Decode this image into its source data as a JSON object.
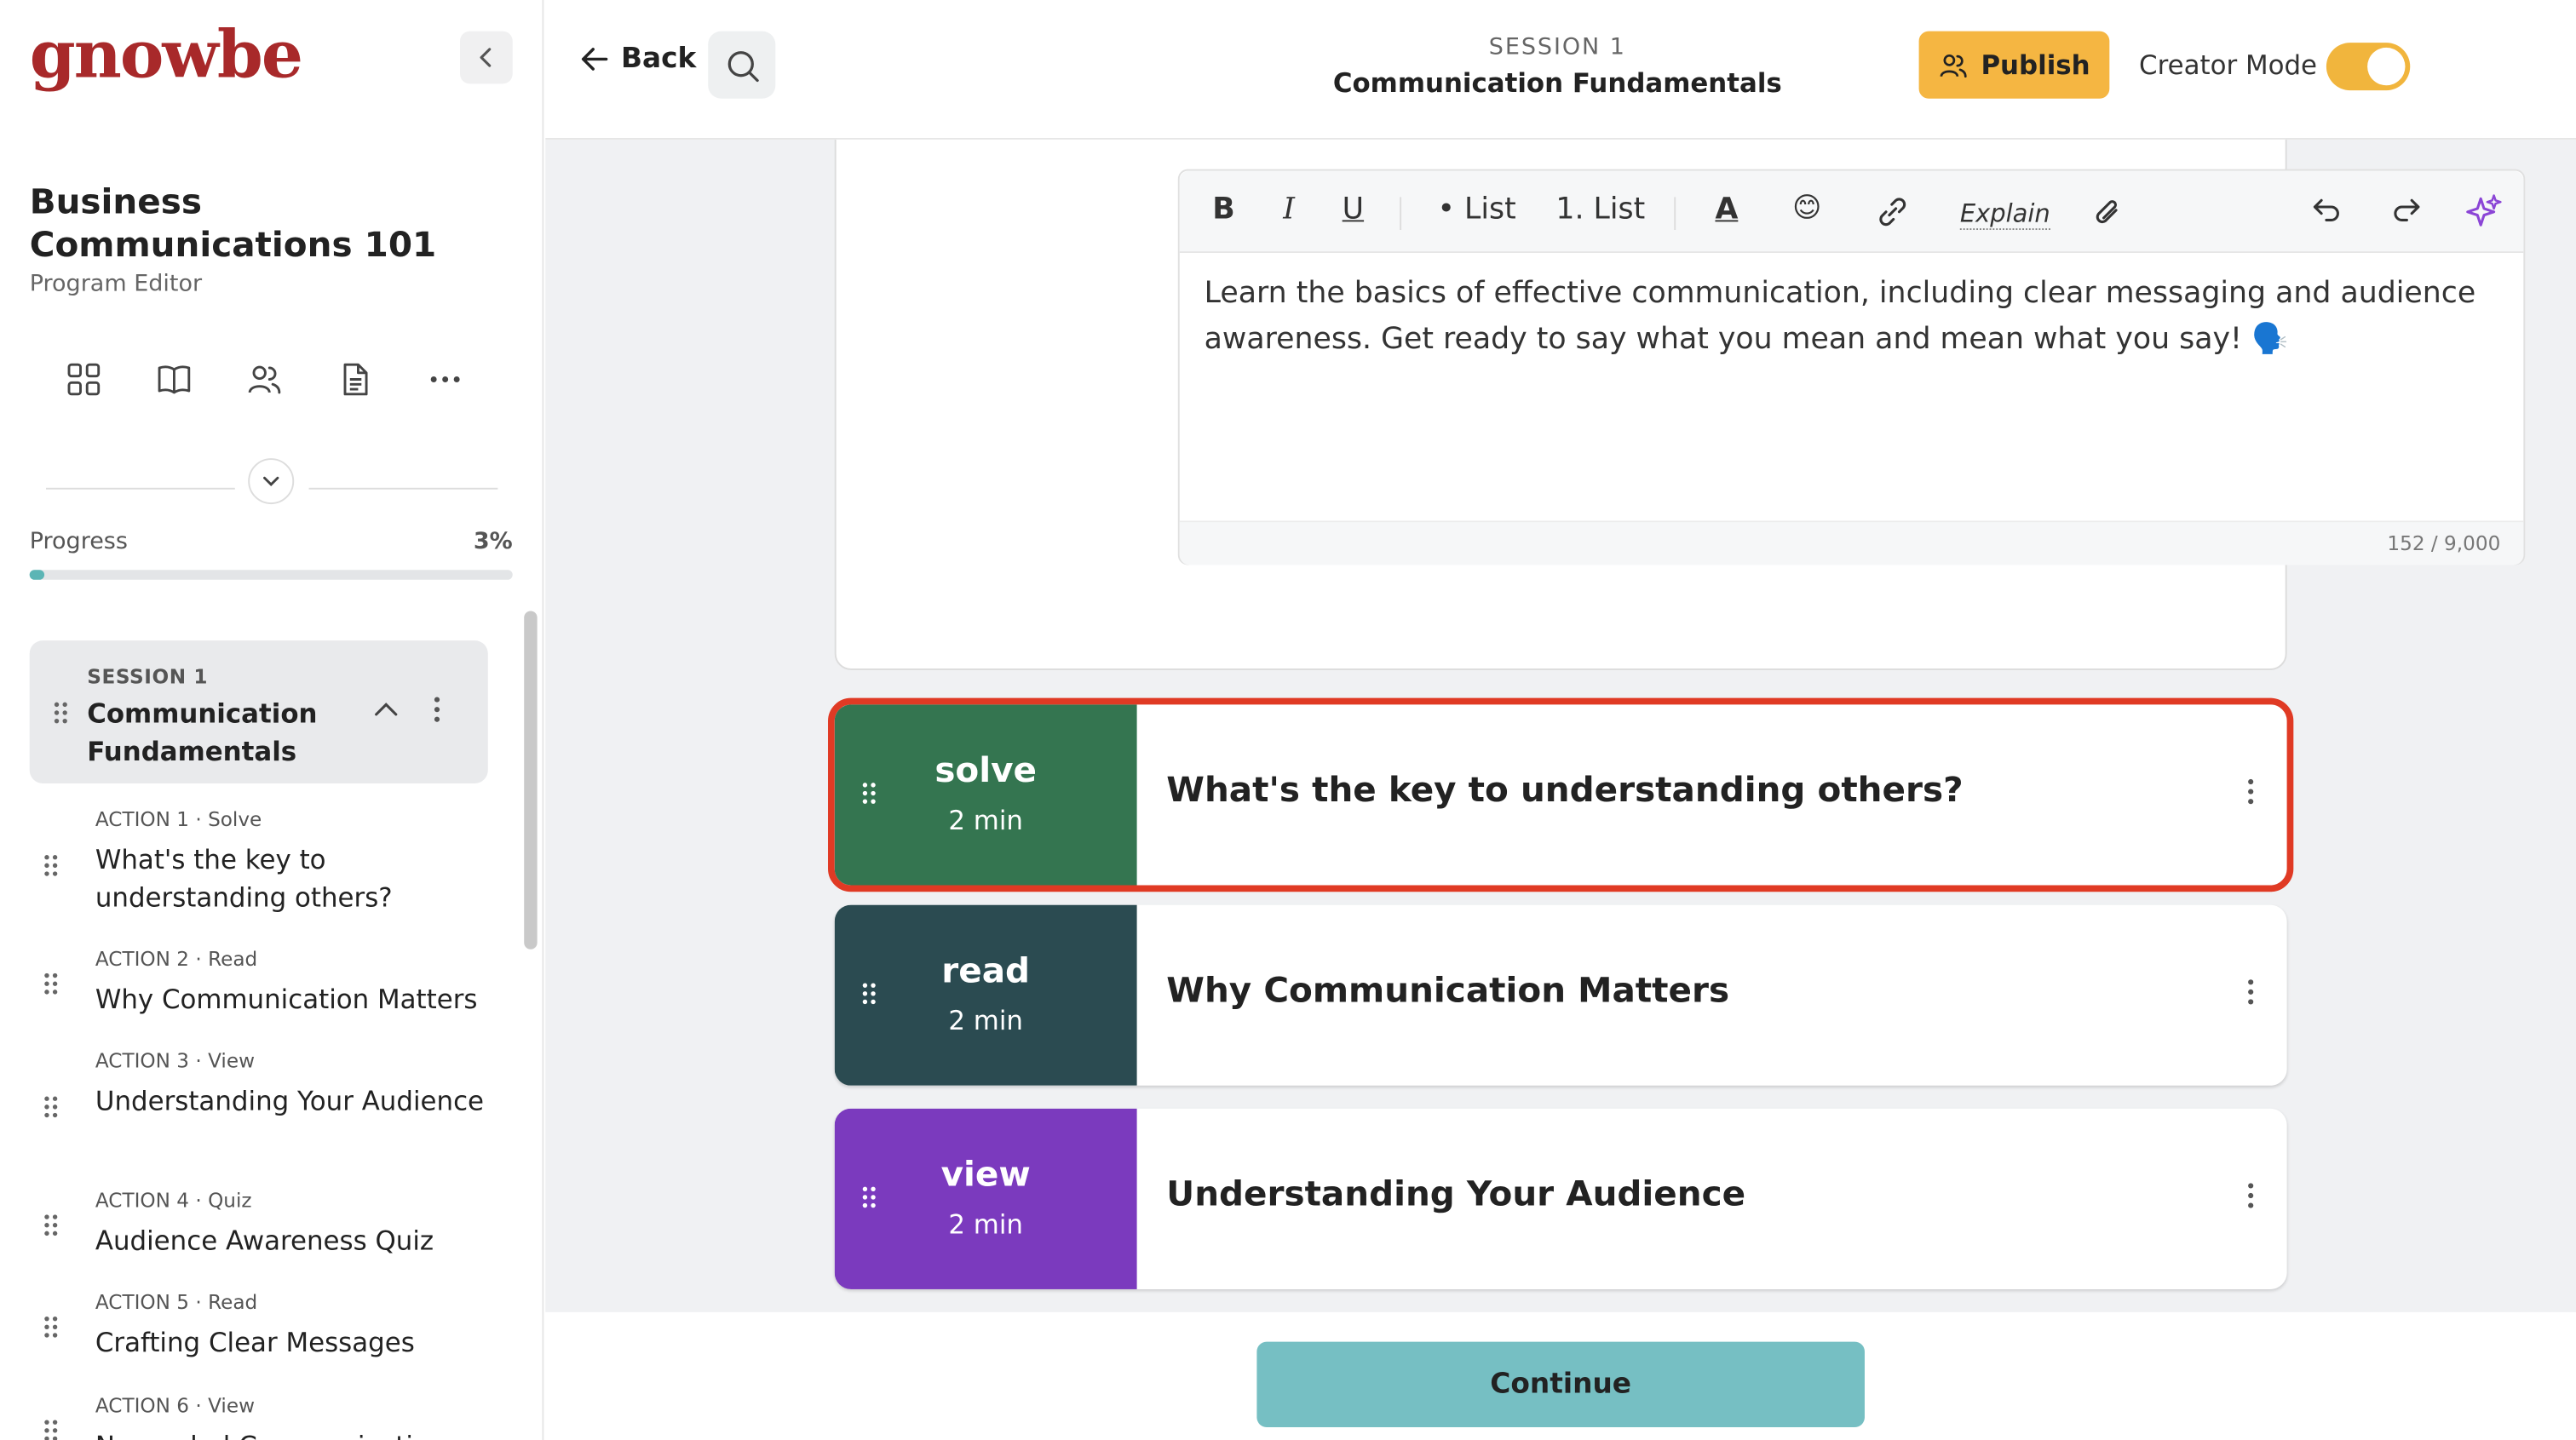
{
  "sidebar": {
    "logo": "gnowbe",
    "program_title": "Business Communications 101",
    "program_subtitle": "Program Editor",
    "nav_icons": [
      "grid-icon",
      "book-icon",
      "users-icon",
      "document-icon",
      "more-icon"
    ],
    "progress": {
      "label": "Progress",
      "value": "3%",
      "fraction": 0.03
    },
    "session": {
      "kicker": "SESSION 1",
      "name": "Communication Fundamentals"
    },
    "actions": [
      {
        "meta": "ACTION 1 · Solve",
        "title": "What's the key to understanding others?"
      },
      {
        "meta": "ACTION 2 · Read",
        "title": "Why Communication Matters"
      },
      {
        "meta": "ACTION 3 · View",
        "title": "Understanding Your Audience"
      },
      {
        "meta": "ACTION 4 · Quiz",
        "title": "Audience Awareness Quiz"
      },
      {
        "meta": "ACTION 5 · Read",
        "title": "Crafting Clear Messages"
      },
      {
        "meta": "ACTION 6 · View",
        "title": "Nonverbal Communication"
      }
    ]
  },
  "header": {
    "back_label": "Back",
    "session_kicker": "SESSION 1",
    "session_title": "Communication Fundamentals",
    "publish_label": "Publish",
    "creator_mode_label": "Creator Mode",
    "creator_mode_on": true
  },
  "editor": {
    "toolbar": {
      "bold": "B",
      "italic": "I",
      "underline": "U",
      "bullet_list": "• List",
      "numbered_list": "1. List",
      "text_color": "A",
      "emoji": "😊",
      "explain": "Explain"
    },
    "body": "Learn the basics of effective communication, including clear messaging and audience awareness. Get ready to say what you mean and mean what you say! 🗣️",
    "char_count": "152 / 9,000"
  },
  "cards": [
    {
      "type": "solve",
      "duration": "2 min",
      "title": "What's the key to understanding others?",
      "color": "#347550",
      "selected": true
    },
    {
      "type": "read",
      "duration": "2 min",
      "title": "Why Communication Matters",
      "color": "#2b4b51",
      "selected": false
    },
    {
      "type": "view",
      "duration": "2 min",
      "title": "Understanding Your Audience",
      "color": "#7b3abe",
      "selected": false
    }
  ],
  "footer": {
    "continue_label": "Continue"
  },
  "colors": {
    "brand": "#a8292a",
    "publish": "#f5b642",
    "toggle": "#f1b53d",
    "continue": "#76bfc3",
    "selection": "#e03a24"
  }
}
